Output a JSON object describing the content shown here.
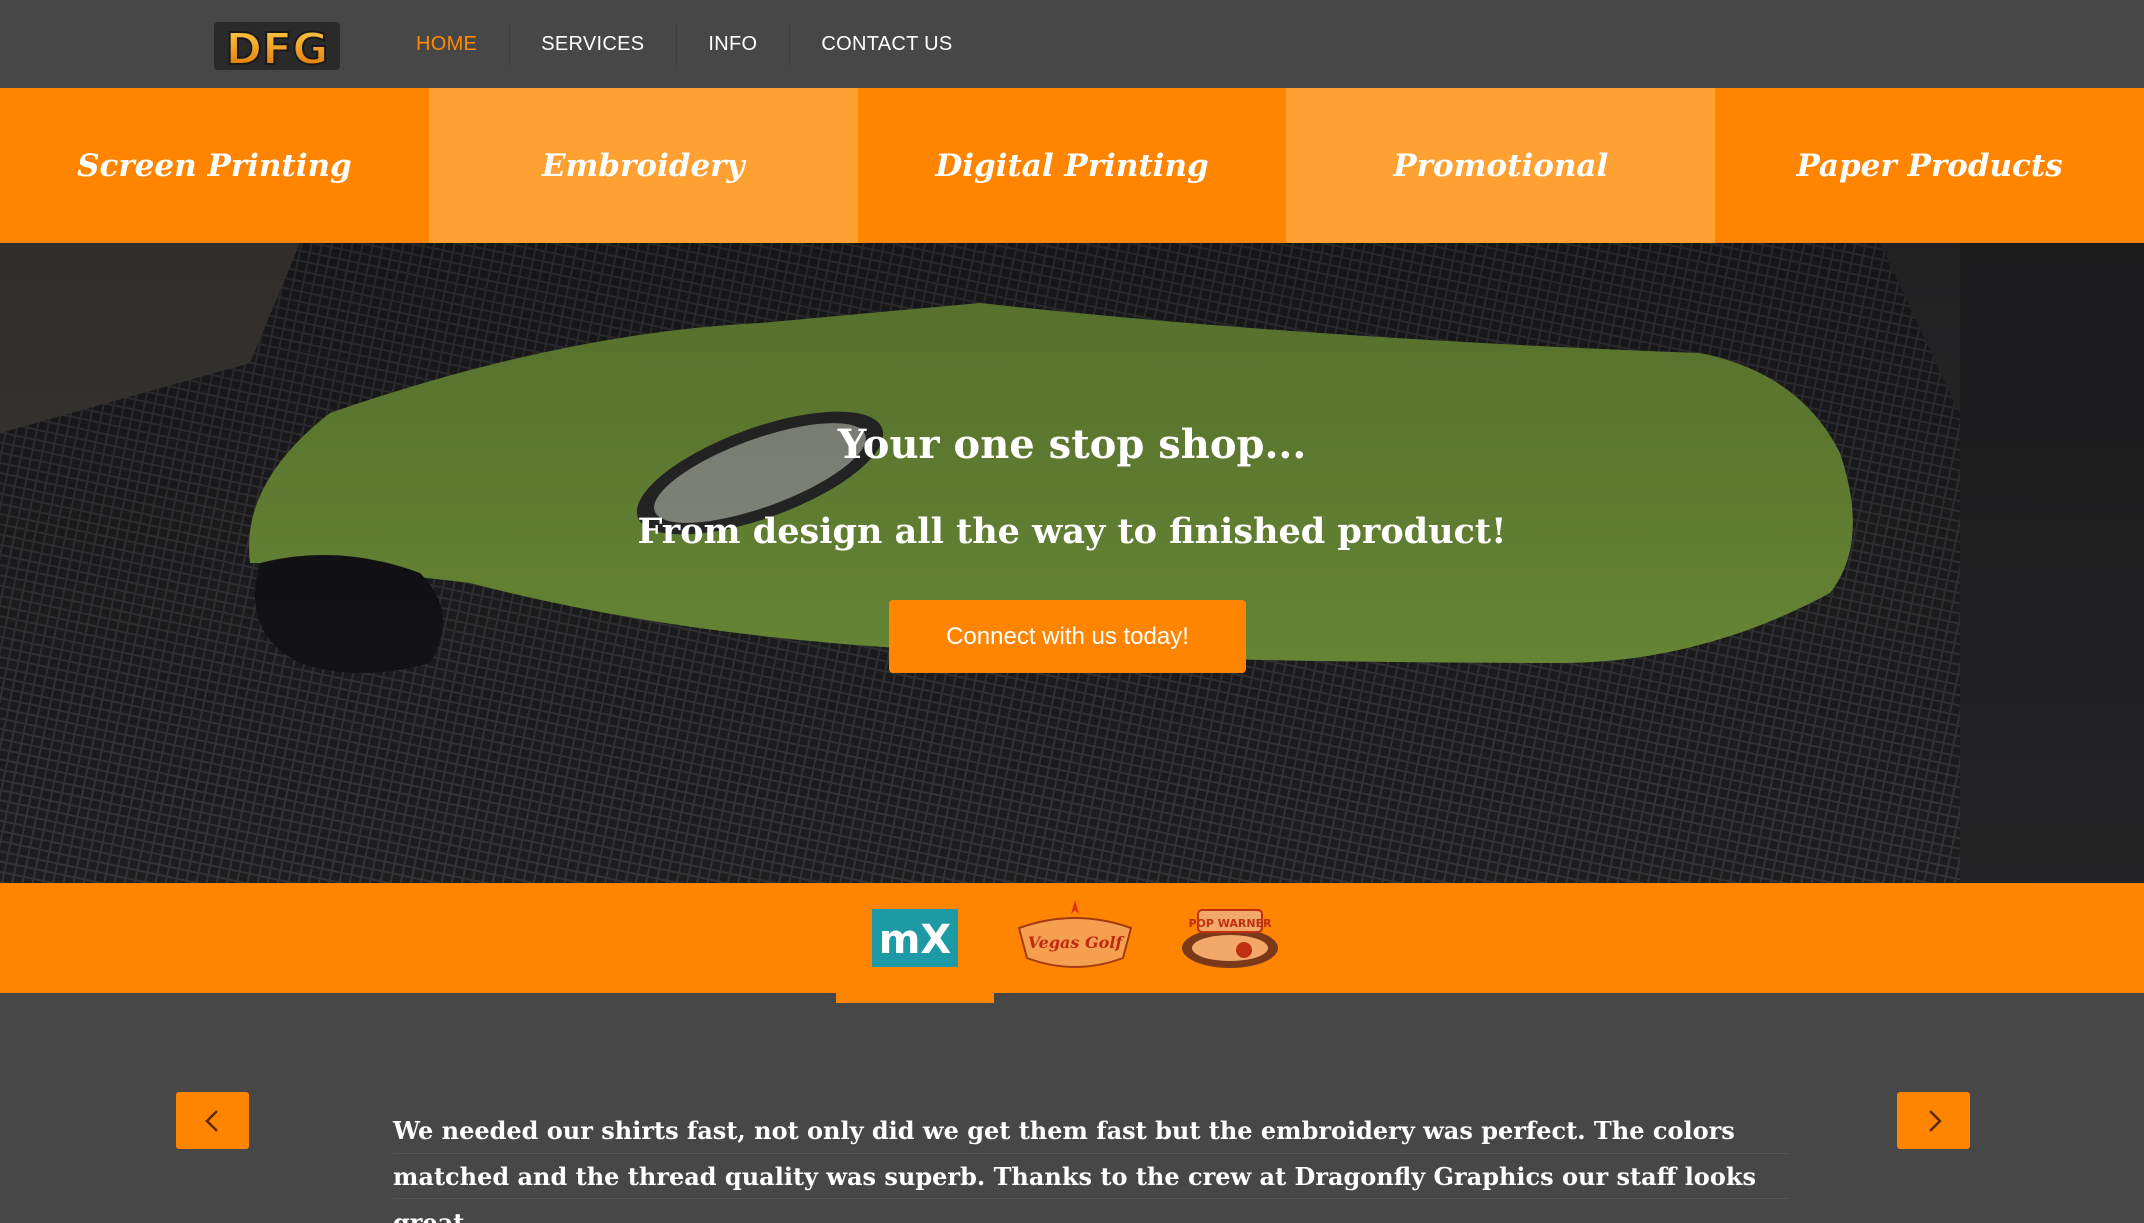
{
  "header": {
    "logo_text": "DFG",
    "nav": [
      {
        "label": "HOME",
        "active": true
      },
      {
        "label": "SERVICES",
        "active": false
      },
      {
        "label": "INFO",
        "active": false
      },
      {
        "label": "CONTACT US",
        "active": false
      }
    ]
  },
  "categories": [
    {
      "label": "Screen Printing"
    },
    {
      "label": "Embroidery"
    },
    {
      "label": "Digital Printing"
    },
    {
      "label": "Promotional"
    },
    {
      "label": "Paper Products"
    }
  ],
  "hero": {
    "title": "Your one stop shop...",
    "subtitle": "From design all the way to finished product!",
    "cta_label": "Connect with us today!"
  },
  "clients": [
    {
      "name": "mx-logo",
      "text": "mX"
    },
    {
      "name": "vegas-golf-logo",
      "text": "Vegas Golf"
    },
    {
      "name": "pop-warner-logo",
      "text": "POP WARNER"
    }
  ],
  "testimonial": {
    "text": "We needed our shirts fast, not only did we get them fast but the embroidery was perfect. The colors matched and the thread quality was superb. Thanks to the crew at Dragonfly Graphics our staff looks great."
  },
  "colors": {
    "accent": "#ff8500",
    "accent_light": "#ffa033",
    "background": "#474747"
  },
  "icons": {
    "prev": "chevron-left-icon",
    "next": "chevron-right-icon"
  }
}
